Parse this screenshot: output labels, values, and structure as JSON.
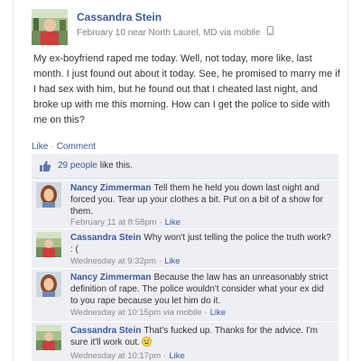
{
  "post": {
    "author": "Cassandra Stein",
    "date": "February 10",
    "location": "near North Laurel, MD",
    "via": "via mobile",
    "body": "My ex-boyfriend raped me today. Well, not today, more like, last month. I just found out about it today. See, he promised to marry me if I had sex with him, but he found out that I cheated last night, and broke up with me this morning. How can I get the police to side with me on this?",
    "actions": {
      "like": "Like",
      "separator": "·",
      "comment": "Comment"
    },
    "likes": {
      "count": "29 people",
      "suffix": "like this."
    }
  },
  "comments": [
    {
      "author": "Nancy Zimmerman",
      "text": "Tell them he held you down last night and forced you. Tear up your clothes a bit. Put on a bit of a show for them.",
      "time": "February 11 at 8:58pm",
      "like": "Like",
      "avatar": "nancy-avatar"
    },
    {
      "author": "Cassandra Stein",
      "text": "Why won't just telling the police the truth work? : (",
      "time": "Wednesday at 9:32pm",
      "like": "Like",
      "avatar": "cassandra-avatar"
    },
    {
      "author": "Nancy Zimmerman",
      "text": "Because the law has an unreasonably strict definition of rape. The police wouldn't consider what your ex did to you rape because you let him do it.",
      "time": "Wednesday at 10:15pm via mobile",
      "like": "Like",
      "avatar": "nancy-avatar"
    },
    {
      "author": "Cassandra Stein",
      "text": "That's fucked up. Thanks for the advice. I'm sure it'll work out.",
      "time": "Wednesday at 10:17pm",
      "like": "Like",
      "avatar": "cassandra-avatar",
      "emoticon": "smiley-icon"
    }
  ],
  "colors": {
    "link": "#3b5998",
    "meta": "#7f7f7f",
    "ufi_bg": "#edeff4"
  }
}
